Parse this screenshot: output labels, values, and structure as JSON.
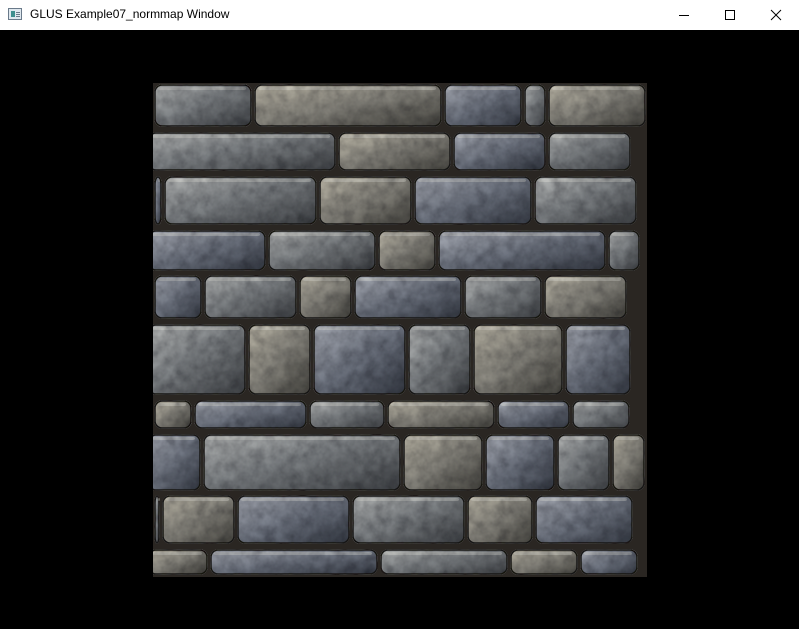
{
  "window": {
    "title": "GLUS Example07_normmap Window",
    "icons": {
      "app": "opengl-window-icon",
      "minimize": "minimize-icon",
      "maximize": "maximize-icon",
      "close": "close-icon"
    }
  },
  "scene": {
    "content": "stone-brick-wall-normal-mapped-quad",
    "background_color": "#000000",
    "mortar_color": "#2a2622",
    "stone_color": "#8a8c8e"
  }
}
